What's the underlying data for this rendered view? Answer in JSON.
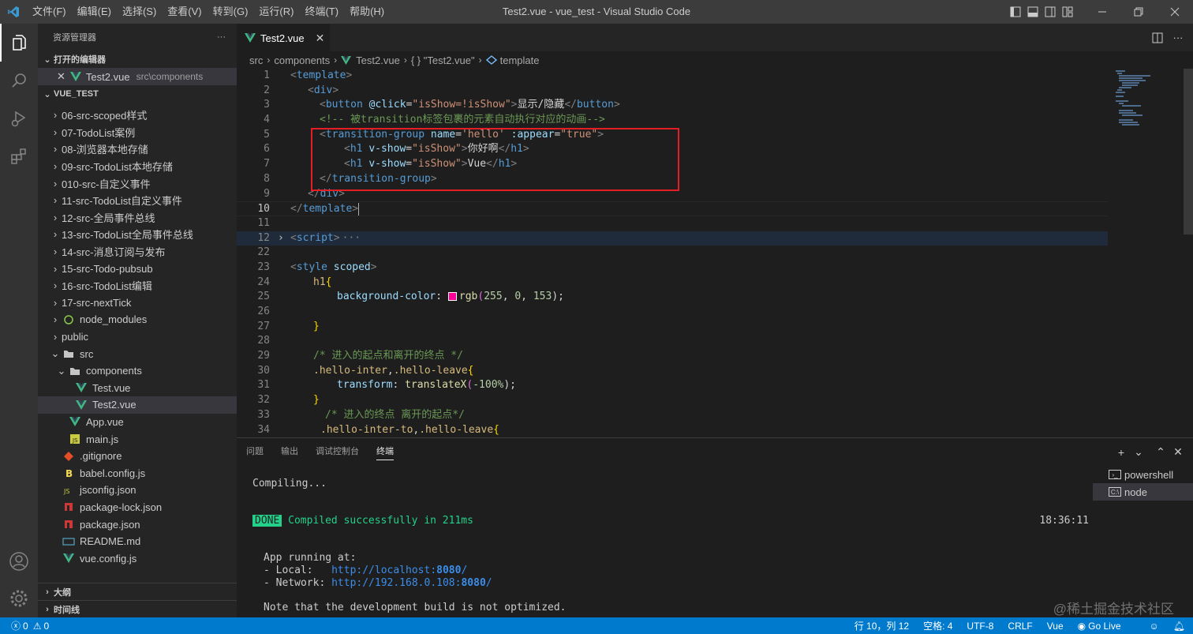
{
  "titlebar": {
    "menu": [
      "文件(F)",
      "编辑(E)",
      "选择(S)",
      "查看(V)",
      "转到(G)",
      "运行(R)",
      "终端(T)",
      "帮助(H)"
    ],
    "title": "Test2.vue - vue_test - Visual Studio Code"
  },
  "sidebar": {
    "title": "资源管理器",
    "more": "···",
    "open_editors_label": "打开的编辑器",
    "open_editor": {
      "name": "Test2.vue",
      "path": "src\\components"
    },
    "project_label": "VUE_TEST",
    "tree": [
      {
        "label": "06-src-scoped样式",
        "type": "folder",
        "indent": 1,
        "open": false
      },
      {
        "label": "07-TodoList案例",
        "type": "folder",
        "indent": 1,
        "open": false
      },
      {
        "label": "08-浏览器本地存储",
        "type": "folder",
        "indent": 1,
        "open": false
      },
      {
        "label": "09-src-TodoList本地存储",
        "type": "folder",
        "indent": 1,
        "open": false
      },
      {
        "label": "010-src-自定义事件",
        "type": "folder",
        "indent": 1,
        "open": false
      },
      {
        "label": "11-src-TodoList自定义事件",
        "type": "folder",
        "indent": 1,
        "open": false
      },
      {
        "label": "12-src-全局事件总线",
        "type": "folder",
        "indent": 1,
        "open": false
      },
      {
        "label": "13-src-TodoList全局事件总线",
        "type": "folder",
        "indent": 1,
        "open": false
      },
      {
        "label": "14-src-消息订阅与发布",
        "type": "folder",
        "indent": 1,
        "open": false
      },
      {
        "label": "15-src-Todo-pubsub",
        "type": "folder",
        "indent": 1,
        "open": false
      },
      {
        "label": "16-src-TodoList编辑",
        "type": "folder",
        "indent": 1,
        "open": false
      },
      {
        "label": "17-src-nextTick",
        "type": "folder",
        "indent": 1,
        "open": false
      },
      {
        "label": "node_modules",
        "type": "node-folder",
        "indent": 1,
        "open": false
      },
      {
        "label": "public",
        "type": "folder",
        "indent": 1,
        "open": false
      },
      {
        "label": "src",
        "type": "folder",
        "indent": 1,
        "open": true
      },
      {
        "label": "components",
        "type": "folder",
        "indent": 2,
        "open": true
      },
      {
        "label": "Test.vue",
        "type": "vue",
        "indent": 3
      },
      {
        "label": "Test2.vue",
        "type": "vue",
        "indent": 3,
        "selected": true
      },
      {
        "label": "App.vue",
        "type": "vue",
        "indent": 2
      },
      {
        "label": "main.js",
        "type": "js",
        "indent": 2
      },
      {
        "label": ".gitignore",
        "type": "git",
        "indent": 1
      },
      {
        "label": "babel.config.js",
        "type": "babel",
        "indent": 1
      },
      {
        "label": "jsconfig.json",
        "type": "json-js",
        "indent": 1
      },
      {
        "label": "package-lock.json",
        "type": "npm",
        "indent": 1
      },
      {
        "label": "package.json",
        "type": "npm",
        "indent": 1
      },
      {
        "label": "README.md",
        "type": "md",
        "indent": 1
      },
      {
        "label": "vue.config.js",
        "type": "vue",
        "indent": 1
      }
    ],
    "outline_label": "大纲",
    "timeline_label": "时间线"
  },
  "editor": {
    "tab": "Test2.vue",
    "tab_close": "✕",
    "breadcrumb": [
      "src",
      "components",
      "Test2.vue",
      "{ } \"Test2.vue\"",
      "template"
    ],
    "lines": [
      {
        "n": "1"
      },
      {
        "n": "2"
      },
      {
        "n": "3"
      },
      {
        "n": "4"
      },
      {
        "n": "5"
      },
      {
        "n": "6"
      },
      {
        "n": "7"
      },
      {
        "n": "8"
      },
      {
        "n": "9"
      },
      {
        "n": "10"
      },
      {
        "n": "11"
      },
      {
        "n": "12"
      },
      {
        "n": "22"
      },
      {
        "n": "23"
      },
      {
        "n": "24"
      },
      {
        "n": "25"
      },
      {
        "n": "26"
      },
      {
        "n": "27"
      },
      {
        "n": "28"
      },
      {
        "n": "29"
      },
      {
        "n": "30"
      },
      {
        "n": "31"
      },
      {
        "n": "32"
      },
      {
        "n": "33"
      },
      {
        "n": "34"
      }
    ],
    "code": {
      "l1": [
        "<",
        "template",
        ">"
      ],
      "l2": [
        "<",
        "div",
        ">"
      ],
      "l3": [
        "<",
        "button",
        " ",
        "@click",
        "=",
        "\"isShow=!isShow\"",
        ">",
        "显示/隐藏",
        "</",
        "button",
        ">"
      ],
      "l4": "<!-- 被transition标签包裹的元素自动执行对应的动画-->",
      "l5": [
        "<",
        "transition-group",
        " ",
        "name",
        "=",
        "'hello'",
        " ",
        ":appear",
        "=",
        "\"true\"",
        ">"
      ],
      "l6": [
        "<",
        "h1",
        " ",
        "v-show",
        "=",
        "\"isShow\"",
        ">",
        "你好啊",
        "</",
        "h1",
        ">"
      ],
      "l7": [
        "<",
        "h1",
        " ",
        "v-show",
        "=",
        "\"isShow\"",
        ">",
        "Vue",
        "</",
        "h1",
        ">"
      ],
      "l8": [
        "</",
        "transition-group",
        ">"
      ],
      "l9": [
        "</",
        "div",
        ">"
      ],
      "l10": [
        "</",
        "template",
        ">"
      ],
      "l12": [
        "<",
        "script",
        ">",
        "···"
      ],
      "l23": [
        "<",
        "style",
        " ",
        "scoped",
        ">"
      ],
      "l24": [
        "h1",
        "{"
      ],
      "l25": [
        "background-color",
        ": ",
        "rgb",
        "(",
        "255",
        ", ",
        "0",
        ", ",
        "153",
        ");"
      ],
      "l27": "}",
      "l29": "/* 进入的起点和离开的终点 */",
      "l30": [
        ".hello-inter",
        ",",
        ".hello-leave",
        "{"
      ],
      "l31": [
        "transform",
        ": ",
        "translateX",
        "(",
        "-100%",
        ");"
      ],
      "l32": "}",
      "l33": "/* 进入的终点 离开的起点*/",
      "l34": [
        ".hello-inter-to",
        ",",
        ".hello-leave",
        "{"
      ]
    },
    "swatch_color": "#ff0099"
  },
  "panel": {
    "tabs": [
      "问题",
      "输出",
      "调试控制台",
      "终端"
    ],
    "active_tab": "终端",
    "actions": [
      "+",
      "⌄",
      "⌃",
      "✕"
    ],
    "terminal": {
      "compiling": "Compiling...",
      "done_badge": "DONE",
      "compiled": "Compiled successfully in 211ms",
      "time": "18:36:11",
      "app_running": "App running at:",
      "local_label": "- Local:   ",
      "local_url_pre": "http://localhost:",
      "local_port": "8080",
      "local_url_post": "/",
      "network_label": "- Network: ",
      "network_url_pre": "http://192.168.0.108:",
      "network_port": "8080",
      "network_url_post": "/",
      "note": "Note that the development build is not optimized."
    },
    "terminals": [
      "powershell",
      "node"
    ]
  },
  "statusbar": {
    "errors": "0",
    "warnings": "0",
    "position": "行 10，列 12",
    "spaces": "空格: 4",
    "encoding": "UTF-8",
    "eol": "CRLF",
    "language": "Vue",
    "golive": "Go Live"
  },
  "watermark": "@稀土掘金技术社区"
}
